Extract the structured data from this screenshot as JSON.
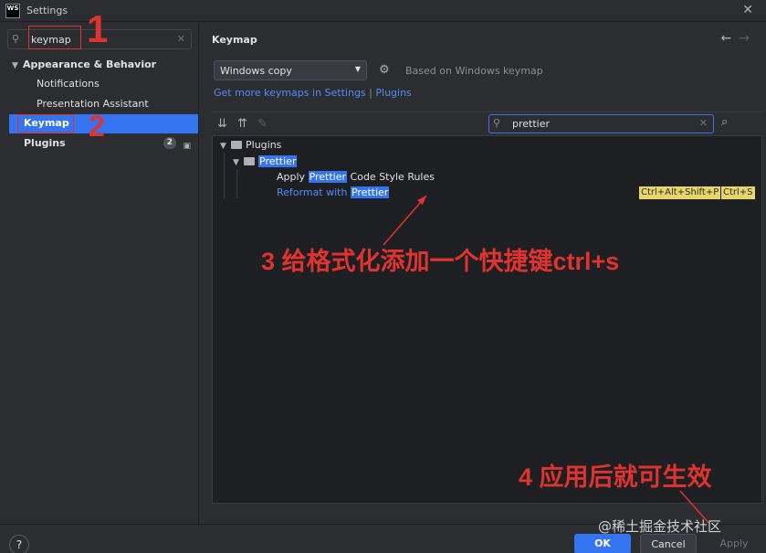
{
  "window": {
    "app_icon_text": "WS",
    "title": "Settings",
    "close_glyph": "✕"
  },
  "sidebar": {
    "search_value": "keymap",
    "items": [
      {
        "label": "Appearance & Behavior",
        "bold": true
      },
      {
        "label": "Notifications"
      },
      {
        "label": "Presentation Assistant"
      },
      {
        "label": "Keymap",
        "selected": true
      },
      {
        "label": "Plugins",
        "badge": "2"
      }
    ]
  },
  "content": {
    "title": "Keymap",
    "back_glyph": "←",
    "forward_glyph": "→",
    "keymap_select": "Windows copy",
    "based_on": "Based on Windows keymap",
    "link_more": "Get more keymaps in Settings",
    "link_sep": "|",
    "link_plugins": "Plugins",
    "filter_value": "prettier",
    "tree": {
      "plugins": "Plugins",
      "prettier": "Prettier",
      "apply_pre": "Apply",
      "apply_hl": "Prettier",
      "apply_post": "Code Style Rules",
      "reformat_pre": "Reformat with",
      "reformat_hl": "Prettier",
      "shortcut1": "Ctrl+Alt+Shift+P",
      "shortcut2": "Ctrl+S"
    }
  },
  "annotations": {
    "n1": "1",
    "n2": "2",
    "step3": "3 给格式化添加一个快捷键ctrl+s",
    "step4": "4 应用后就可生效"
  },
  "footer": {
    "help": "?",
    "ok": "OK",
    "cancel": "Cancel",
    "apply": "Apply"
  },
  "watermark": "@稀土掘金技术社区",
  "colors": {
    "accent": "#3574f0",
    "annotation_red": "#e0322f",
    "shortcut_yellow": "#e9d66b"
  }
}
